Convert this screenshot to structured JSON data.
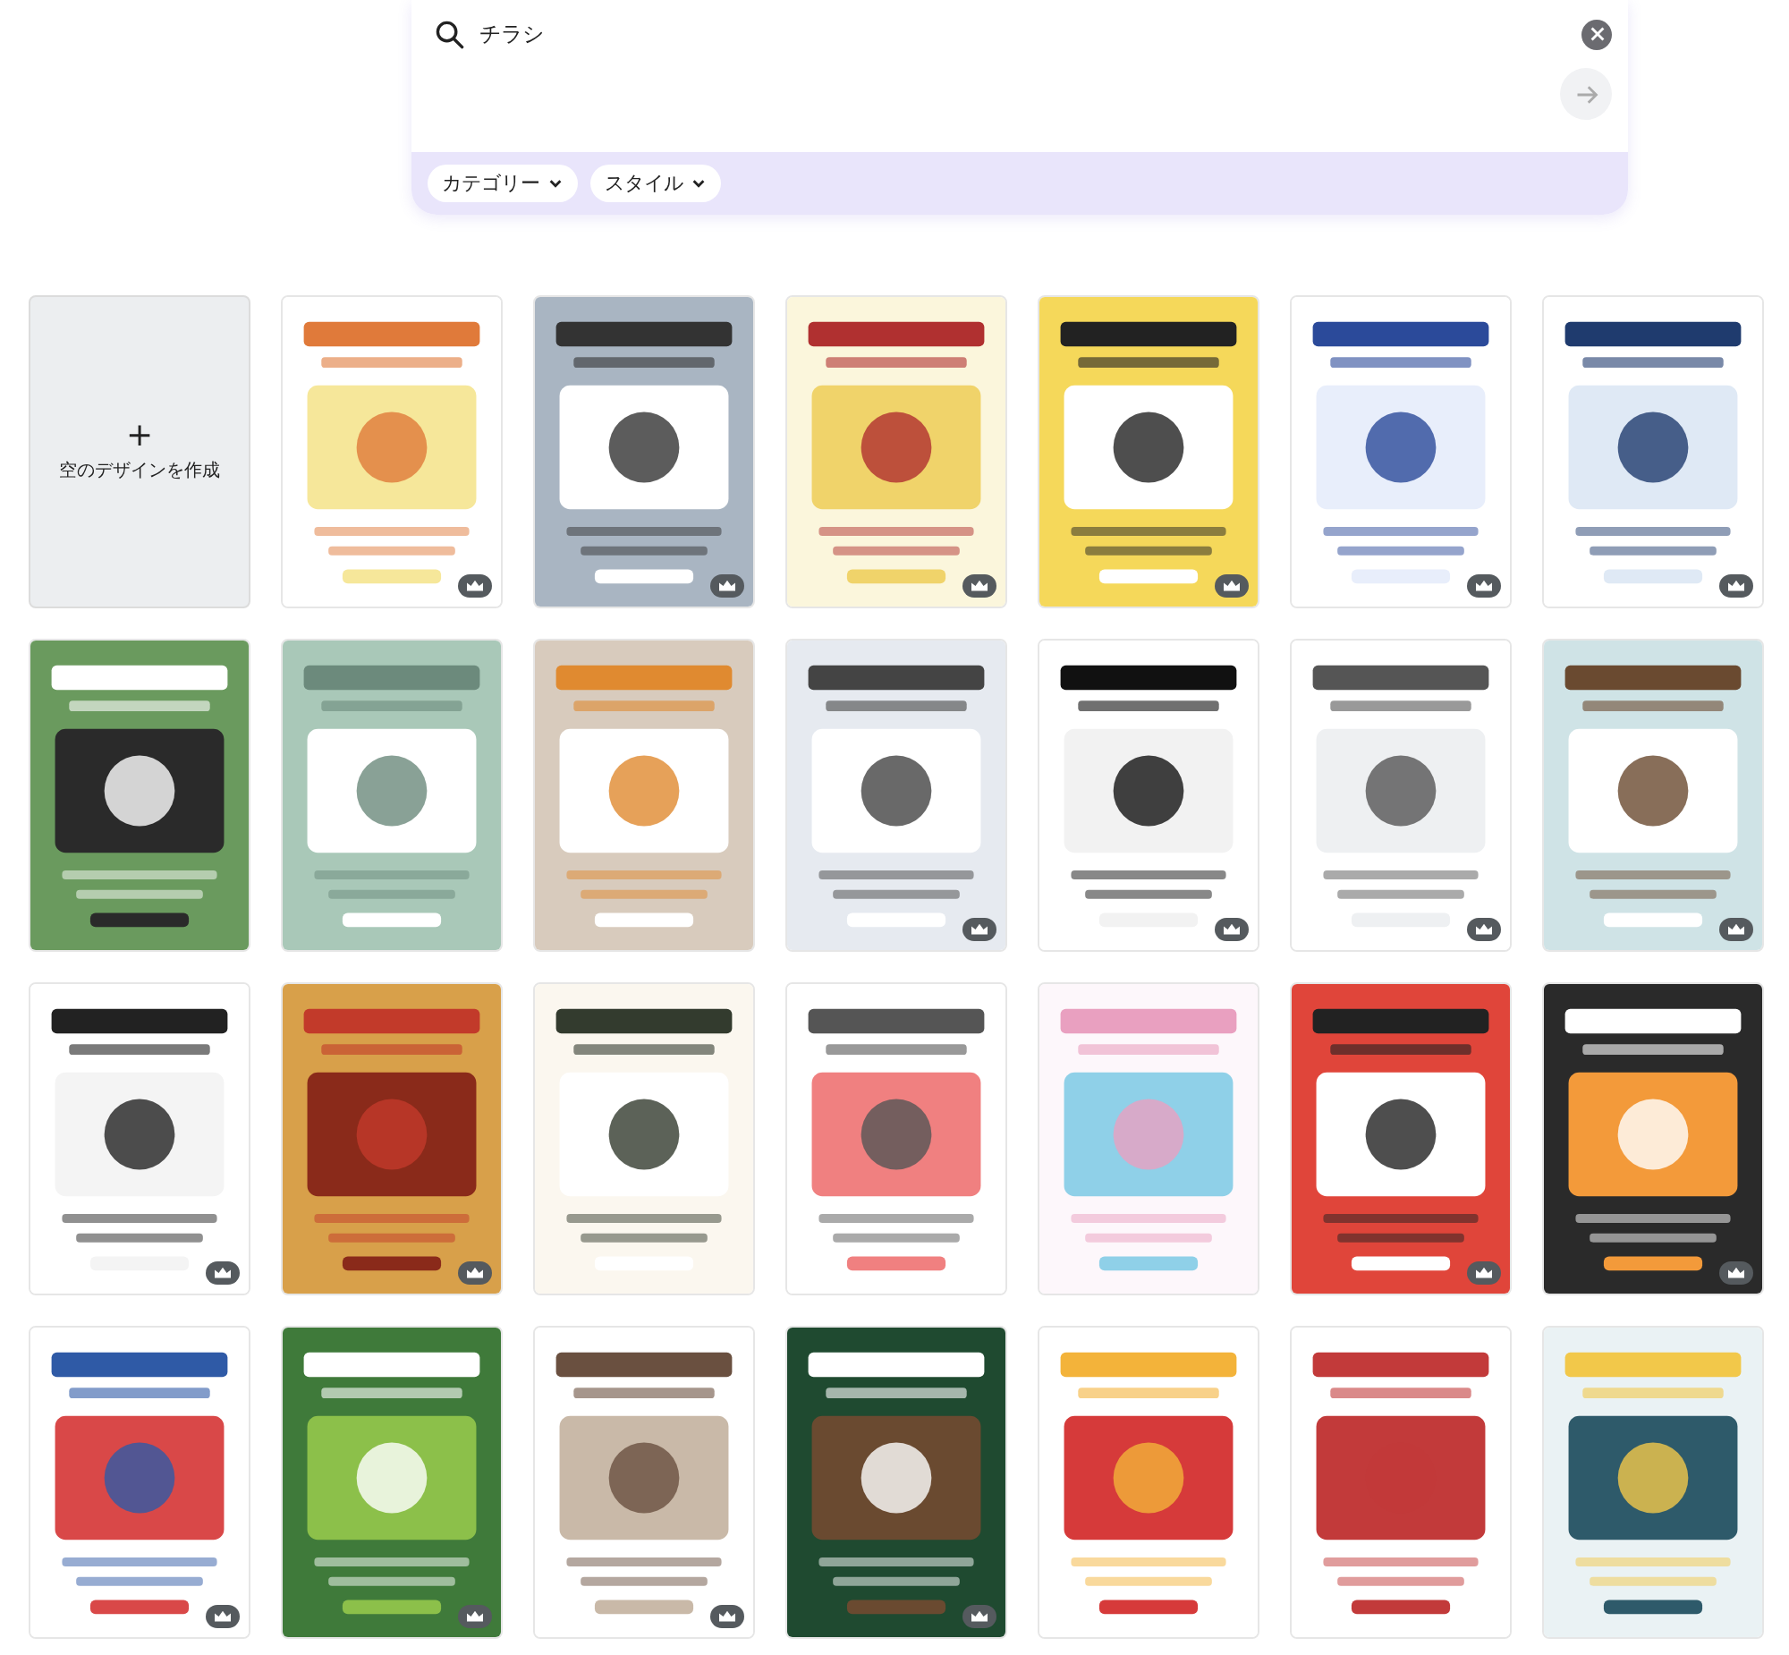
{
  "search": {
    "value": "チラシ",
    "filters": [
      {
        "label": "カテゴリー"
      },
      {
        "label": "スタイル"
      }
    ]
  },
  "create_blank": {
    "label": "空のデザインを作成",
    "icon": "+"
  },
  "templates": [
    {
      "kind": "picture",
      "premium": true
    },
    {
      "kind": "picture",
      "premium": true
    },
    {
      "kind": "picture",
      "premium": true
    },
    {
      "kind": "picture",
      "premium": true
    },
    {
      "kind": "picture",
      "premium": true
    },
    {
      "kind": "picture",
      "premium": true
    },
    {
      "kind": "picture",
      "premium": false
    },
    {
      "kind": "picture",
      "premium": false
    },
    {
      "kind": "picture",
      "premium": false
    },
    {
      "kind": "picture",
      "premium": true
    },
    {
      "kind": "picture",
      "premium": true
    },
    {
      "kind": "picture",
      "premium": true
    },
    {
      "kind": "picture",
      "premium": true
    },
    {
      "kind": "picture",
      "premium": true
    },
    {
      "kind": "picture",
      "premium": true
    },
    {
      "kind": "picture",
      "premium": false
    },
    {
      "kind": "picture",
      "premium": false
    },
    {
      "kind": "picture",
      "premium": false
    },
    {
      "kind": "picture",
      "premium": true
    },
    {
      "kind": "picture",
      "premium": true
    },
    {
      "kind": "picture",
      "premium": true
    },
    {
      "kind": "picture",
      "premium": true
    },
    {
      "kind": "picture",
      "premium": true
    },
    {
      "kind": "picture",
      "premium": true
    },
    {
      "kind": "picture",
      "premium": false
    },
    {
      "kind": "picture",
      "premium": false
    },
    {
      "kind": "picture",
      "premium": false
    }
  ]
}
